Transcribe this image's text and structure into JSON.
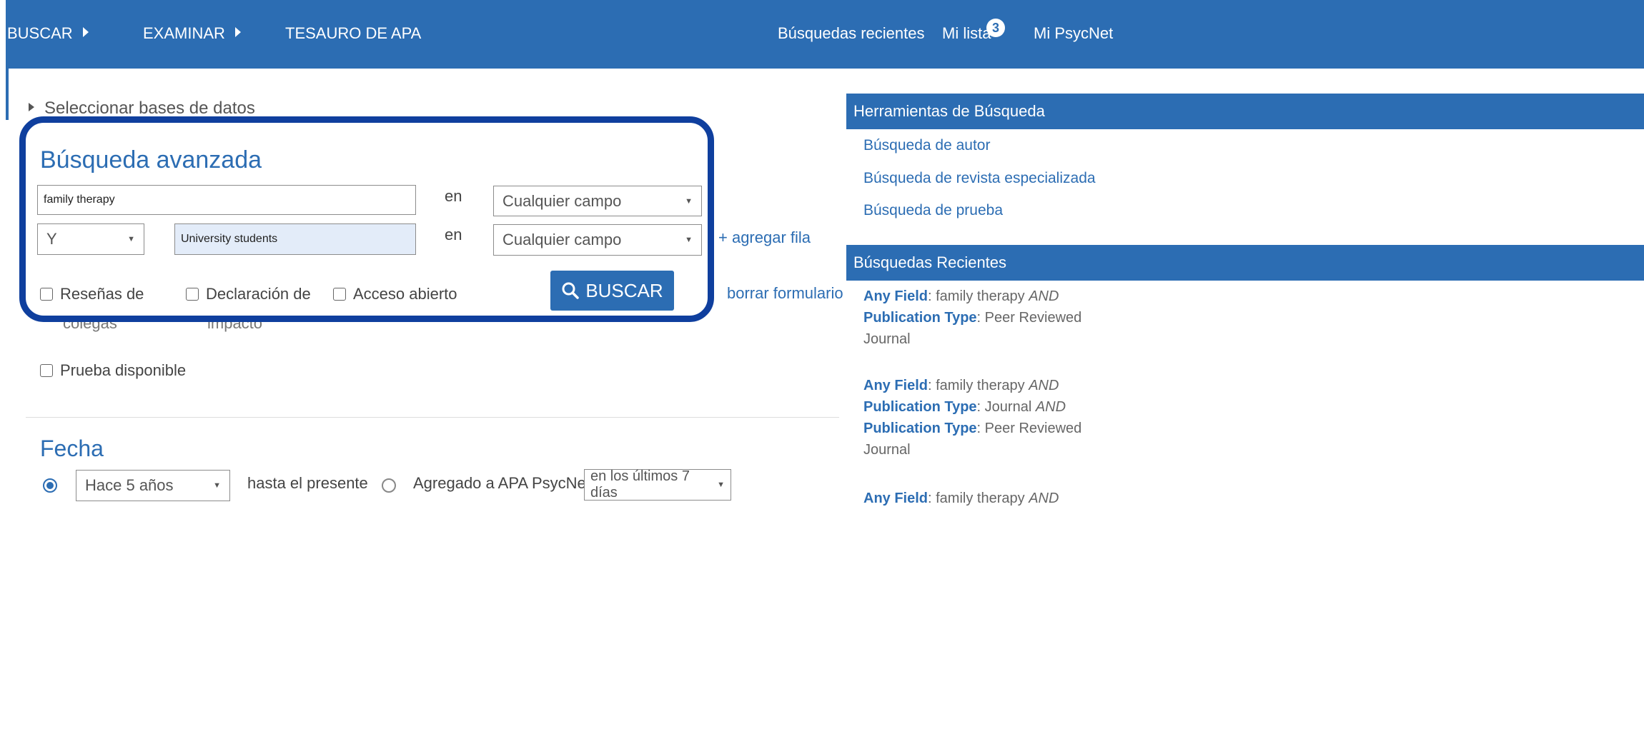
{
  "nav": {
    "buscar": "BUSCAR",
    "examinar": "EXAMINAR",
    "tesauro": "TESAURO DE APA",
    "recientes": "Búsquedas recientes",
    "mi_lista": "Mi lista",
    "mi_lista_count": "3",
    "mi_psycnet": "Mi PsycNet"
  },
  "select_databases": "Seleccionar bases de datos",
  "advanced": {
    "title": "Búsqueda avanzada",
    "row1": {
      "query": "family therapy",
      "en": "en",
      "field": "Cualquier campo"
    },
    "row2": {
      "operator": "Y",
      "query": "University students",
      "en": "en",
      "field": "Cualquier campo"
    },
    "add_row": "+ agregar fila",
    "search_button": "BUSCAR",
    "clear_form": "borrar formulario",
    "filters": {
      "peer_reviewed_1": "Reseñas de",
      "peer_reviewed_2": "colegas",
      "impact_1": "Declaración de",
      "impact_2": "impacto",
      "open_access": "Acceso abierto",
      "test_available": "Prueba disponible"
    }
  },
  "date": {
    "title": "Fecha",
    "range_select": "Hace 5 años",
    "until_present": "hasta el presente",
    "added_label": "Agregado a APA PsycNet",
    "added_select": "en los últimos 7 días"
  },
  "sidebar": {
    "tools_title": "Herramientas de Búsqueda",
    "tools": [
      "Búsqueda de autor",
      "Búsqueda de revista especializada",
      "Búsqueda de prueba"
    ],
    "recent_title": "Búsquedas Recientes",
    "recent": [
      {
        "f1": "Any Field",
        "v1": ": family therapy ",
        "op1": "AND",
        "f2": "Publication Type",
        "v2": ": Peer Reviewed Journal"
      },
      {
        "f1": "Any Field",
        "v1": ": family therapy ",
        "op1": "AND",
        "f2": "Publication Type",
        "v2": ": Journal ",
        "op2": "AND",
        "f3": "Publication Type",
        "v3": ": Peer Reviewed Journal"
      },
      {
        "f1": "Any Field",
        "v1": ": family therapy ",
        "op1": "AND"
      }
    ]
  },
  "colors": {
    "primary": "#2c6db3",
    "highlight_frame": "#0f3f9e"
  }
}
